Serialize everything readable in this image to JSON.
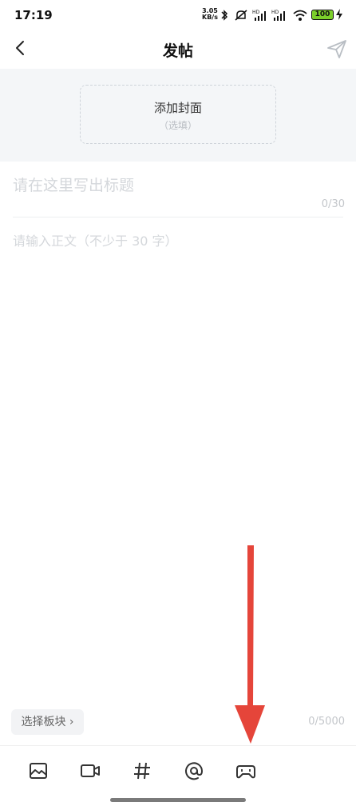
{
  "status_bar": {
    "time": "17:19",
    "net_speed_value": "3.05",
    "net_speed_unit": "KB/s",
    "battery": "100"
  },
  "header": {
    "title": "发帖"
  },
  "cover": {
    "label": "添加封面",
    "hint": "（选填）"
  },
  "title_field": {
    "placeholder": "请在这里写出标题",
    "counter": "0/30"
  },
  "body_field": {
    "placeholder": "请输入正文（不少于 30 字）",
    "counter": "0/5000"
  },
  "board_selector": {
    "label": "选择板块 ›"
  },
  "toolbar": {
    "items": [
      "image-icon",
      "video-icon",
      "hashtag-icon",
      "at-icon",
      "gamepad-icon"
    ]
  },
  "colors": {
    "annotation_arrow": "#e5453a",
    "battery_fill": "#7ccf2a"
  }
}
